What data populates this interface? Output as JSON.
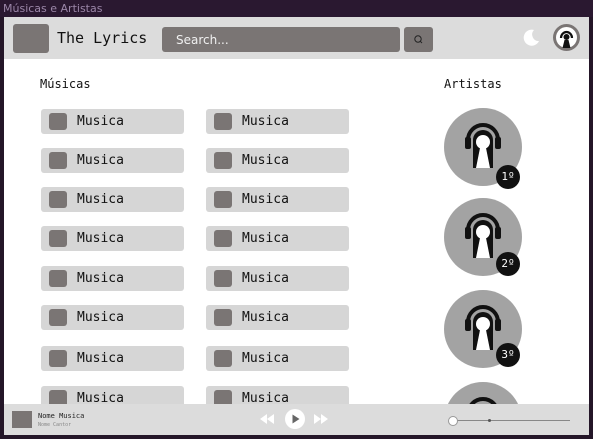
{
  "window": {
    "title": "Músicas e Artistas"
  },
  "header": {
    "app_title": "The Lyrics",
    "search_placeholder": "Search..."
  },
  "songs_section": {
    "title": "Músicas"
  },
  "artists_section": {
    "title": "Artistas"
  },
  "songs": {
    "left": [
      "Musica",
      "Musica",
      "Musica",
      "Musica",
      "Musica",
      "Musica",
      "Musica",
      "Musica"
    ],
    "right": [
      "Musica",
      "Musica",
      "Musica",
      "Musica",
      "Musica",
      "Musica",
      "Musica",
      "Musica"
    ]
  },
  "artists": [
    {
      "rank": "1º"
    },
    {
      "rank": "2º"
    },
    {
      "rank": "3º"
    },
    {
      "rank": ""
    }
  ],
  "player": {
    "title": "Nome Musica",
    "artist": "Nome Cantor",
    "volume": 0.3
  },
  "colors": {
    "accent_gray": "#7a7574",
    "tile": "#d6d6d6",
    "bar": "#dcdcdc"
  },
  "icons": [
    "logo-icon",
    "search-icon",
    "moon-icon",
    "user-avatar-icon",
    "headphones-person-icon",
    "rewind-icon",
    "play-icon",
    "fast-forward-icon"
  ]
}
